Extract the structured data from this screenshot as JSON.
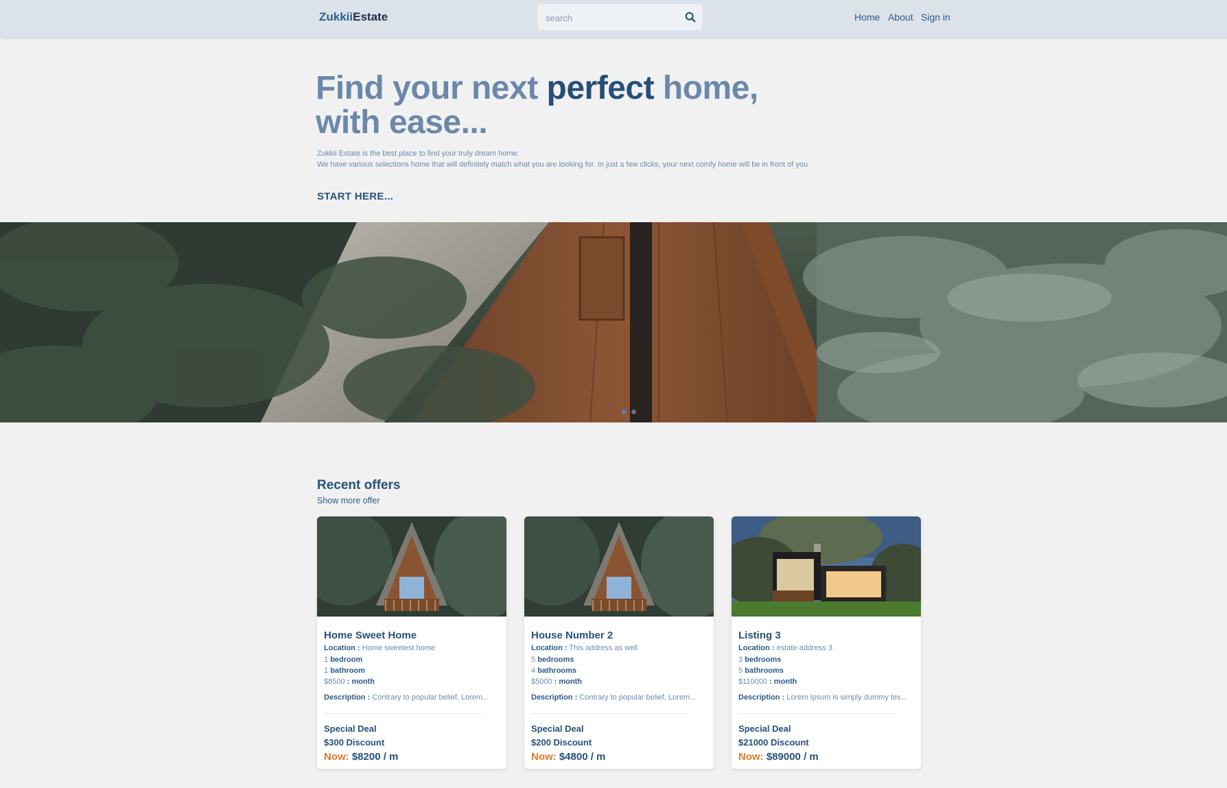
{
  "navbar": {
    "brand_part1": "Zukkii",
    "brand_part2": "Estate",
    "search_placeholder": "search",
    "links": [
      "Home",
      "About",
      "Sign in"
    ]
  },
  "hero": {
    "headline_part1": "Find your next ",
    "headline_strong": "perfect",
    "headline_part2": " home,",
    "headline_line2": "with ease...",
    "sub_line1": "Zukkii Estate is the best place to find your truly dream home.",
    "sub_line2": "We have various selections home that will definitely match what you are looking for. In just a few clicks, your next comfy home will be in front of you",
    "cta": "START HERE..."
  },
  "recent": {
    "title": "Recent offers",
    "show_more": "Show more offer"
  },
  "cards": [
    {
      "title": "Home Sweet Home",
      "location_label": "Location :",
      "location": "Home sweetest home",
      "bedrooms_count": "1",
      "bedrooms_label": "bedroom",
      "bathrooms_count": "1",
      "bathrooms_label": "bathroom",
      "price": "$8500",
      "price_label": ": month",
      "description_label": "Description :",
      "description": "Contrary to popular belief, Lorem...",
      "deal": "Special Deal",
      "discount": "$300 Discount",
      "now_label": "Now:",
      "now_price": "$8200 / m"
    },
    {
      "title": "House Number 2",
      "location_label": "Location :",
      "location": "This address as well",
      "bedrooms_count": "5",
      "bedrooms_label": "bedrooms",
      "bathrooms_count": "4",
      "bathrooms_label": "bathrooms",
      "price": "$5000",
      "price_label": ": month",
      "description_label": "Description :",
      "description": "Contrary to popular belief, Lorem...",
      "deal": "Special Deal",
      "discount": "$200 Discount",
      "now_label": "Now:",
      "now_price": "$4800 / m"
    },
    {
      "title": "Listing 3",
      "location_label": "Location :",
      "location": "estate address 3",
      "bedrooms_count": "3",
      "bedrooms_label": "bedrooms",
      "bathrooms_count": "5",
      "bathrooms_label": "bathrooms",
      "price": "$110000",
      "price_label": ": month",
      "description_label": "Description :",
      "description": "Lorem Ipsum is simply dummy tex...",
      "deal": "Special Deal",
      "discount": "$21000 Discount",
      "now_label": "Now:",
      "now_price": "$89000 / m"
    }
  ],
  "icons": {
    "search": "search-icon"
  },
  "colors": {
    "primary": "#27507a",
    "muted": "#6a8aae",
    "accent": "#e07b2c",
    "navbar_bg": "#dce2ea",
    "page_bg": "#f1f1f1"
  }
}
